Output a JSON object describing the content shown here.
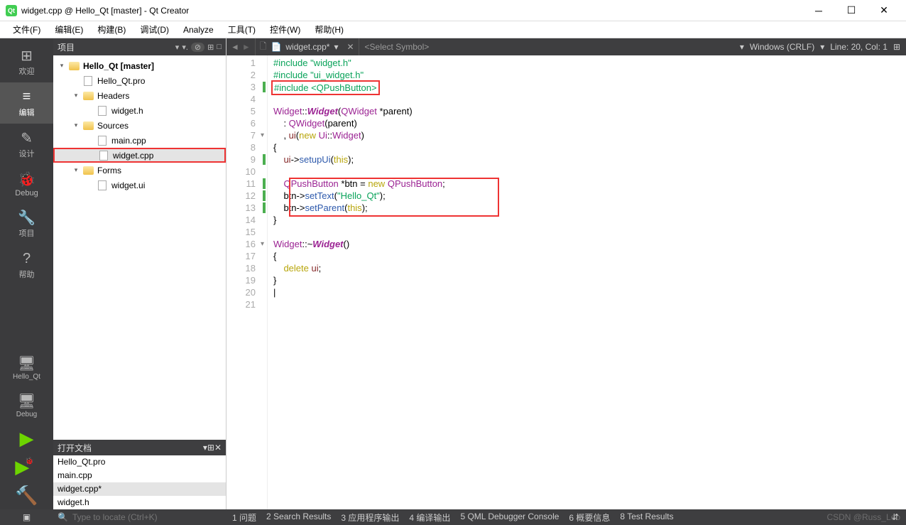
{
  "title": "widget.cpp @ Hello_Qt [master] - Qt Creator",
  "qt_icon_label": "Qt",
  "menus": [
    "文件(F)",
    "编辑(E)",
    "构建(B)",
    "调试(D)",
    "Analyze",
    "工具(T)",
    "控件(W)",
    "帮助(H)"
  ],
  "rail": {
    "top": [
      {
        "icon": "⊞",
        "label": "欢迎"
      },
      {
        "icon": "≡",
        "label": "编辑",
        "active": true
      },
      {
        "icon": "✎",
        "label": "设计"
      },
      {
        "icon": "🐞",
        "label": "Debug"
      },
      {
        "icon": "🔧",
        "label": "项目"
      },
      {
        "icon": "?",
        "label": "帮助"
      }
    ],
    "bot": [
      {
        "icon": "🖥",
        "label": "Hello_Qt"
      },
      {
        "icon": "🖥",
        "label": "Debug"
      },
      {
        "icon": "▶",
        "label": ""
      },
      {
        "icon": "▶",
        "label": "",
        "bug": true
      },
      {
        "icon": "🔨",
        "label": ""
      }
    ]
  },
  "project_panel": {
    "title": "项目",
    "tree": [
      {
        "d": 0,
        "tw": "▾",
        "ico": "fold",
        "txt": "Hello_Qt [master]",
        "bold": true
      },
      {
        "d": 1,
        "tw": "",
        "ico": "file",
        "txt": "Hello_Qt.pro"
      },
      {
        "d": 1,
        "tw": "▾",
        "ico": "fold",
        "txt": "Headers"
      },
      {
        "d": 2,
        "tw": "",
        "ico": "file",
        "txt": "widget.h"
      },
      {
        "d": 1,
        "tw": "▾",
        "ico": "fold",
        "txt": "Sources"
      },
      {
        "d": 2,
        "tw": "",
        "ico": "file",
        "txt": "main.cpp"
      },
      {
        "d": 2,
        "tw": "",
        "ico": "file",
        "txt": "widget.cpp",
        "sel": true,
        "box": true
      },
      {
        "d": 1,
        "tw": "▾",
        "ico": "fold",
        "txt": "Forms"
      },
      {
        "d": 2,
        "tw": "",
        "ico": "file",
        "txt": "widget.ui"
      }
    ]
  },
  "open_docs": {
    "title": "打开文档",
    "items": [
      {
        "txt": "Hello_Qt.pro"
      },
      {
        "txt": "main.cpp"
      },
      {
        "txt": "widget.cpp*",
        "sel": true
      },
      {
        "txt": "widget.h"
      }
    ]
  },
  "editor": {
    "file_label": "widget.cpp*",
    "symbol_placeholder": "<Select Symbol>",
    "encoding": "Windows (CRLF)",
    "pos": "Line: 20, Col: 1",
    "lines": [
      {
        "n": 1,
        "html": "<span class='kw-inc'>#include</span> <span class='kw-str'>\"widget.h\"</span>"
      },
      {
        "n": 2,
        "html": "<span class='kw-inc'>#include</span> <span class='kw-str'>\"ui_widget.h\"</span>"
      },
      {
        "n": 3,
        "mark": "g",
        "html": "<span class='hlbox'><span class='kw-inc'>#include</span> <span class='kw-str'>&lt;QPushButton&gt;</span></span>"
      },
      {
        "n": 4,
        "html": ""
      },
      {
        "n": 5,
        "html": "<span class='kw-type'>Widget</span>::<span class='kw-nm'>Widget</span>(<span class='kw-type'>QWidget</span> *parent)"
      },
      {
        "n": 6,
        "html": "    : <span class='kw-type'>QWidget</span>(parent)"
      },
      {
        "n": 7,
        "fold": true,
        "html": "    , <span class='kw-mem'>ui</span>(<span class='kw-new'>new</span> <span class='kw-type'>Ui</span>::<span class='kw-type'>Widget</span>)"
      },
      {
        "n": 8,
        "html": "{"
      },
      {
        "n": 9,
        "mark": "g",
        "html": "    <span class='kw-mem'>ui</span>-&gt;<span class='kw-fn'>setupUi</span>(<span class='kw-this'>this</span>);"
      },
      {
        "n": 10,
        "html": ""
      },
      {
        "n": 11,
        "mark": "g",
        "html": "    <span class='kw-type'>QPushButton</span> *btn = <span class='kw-new'>new</span> <span class='kw-type'>QPushButton</span>;"
      },
      {
        "n": 12,
        "mark": "g",
        "html": "    btn-&gt;<span class='kw-fn'>setText</span>(<span class='kw-str'>\"Hello_Qt\"</span>);"
      },
      {
        "n": 13,
        "mark": "g",
        "html": "    btn-&gt;<span class='kw-fn'>setParent</span>(<span class='kw-this'>this</span>);"
      },
      {
        "n": 14,
        "html": "}"
      },
      {
        "n": 15,
        "html": ""
      },
      {
        "n": 16,
        "fold": true,
        "html": "<span class='kw-type'>Widget</span>::~<span class='kw-nm'>Widget</span>()"
      },
      {
        "n": 17,
        "html": "{"
      },
      {
        "n": 18,
        "html": "    <span class='kw-new'>delete</span> <span class='kw-mem'>ui</span>;"
      },
      {
        "n": 19,
        "html": "}"
      },
      {
        "n": 20,
        "html": "|"
      },
      {
        "n": 21,
        "html": ""
      }
    ]
  },
  "status": {
    "search_placeholder": "Type to locate (Ctrl+K)",
    "tabs": [
      "1 问题",
      "2 Search Results",
      "3 应用程序输出",
      "4 编译输出",
      "5 QML Debugger Console",
      "6 概要信息",
      "8 Test Results"
    ]
  },
  "watermark": "CSDN @Russ_Leo"
}
